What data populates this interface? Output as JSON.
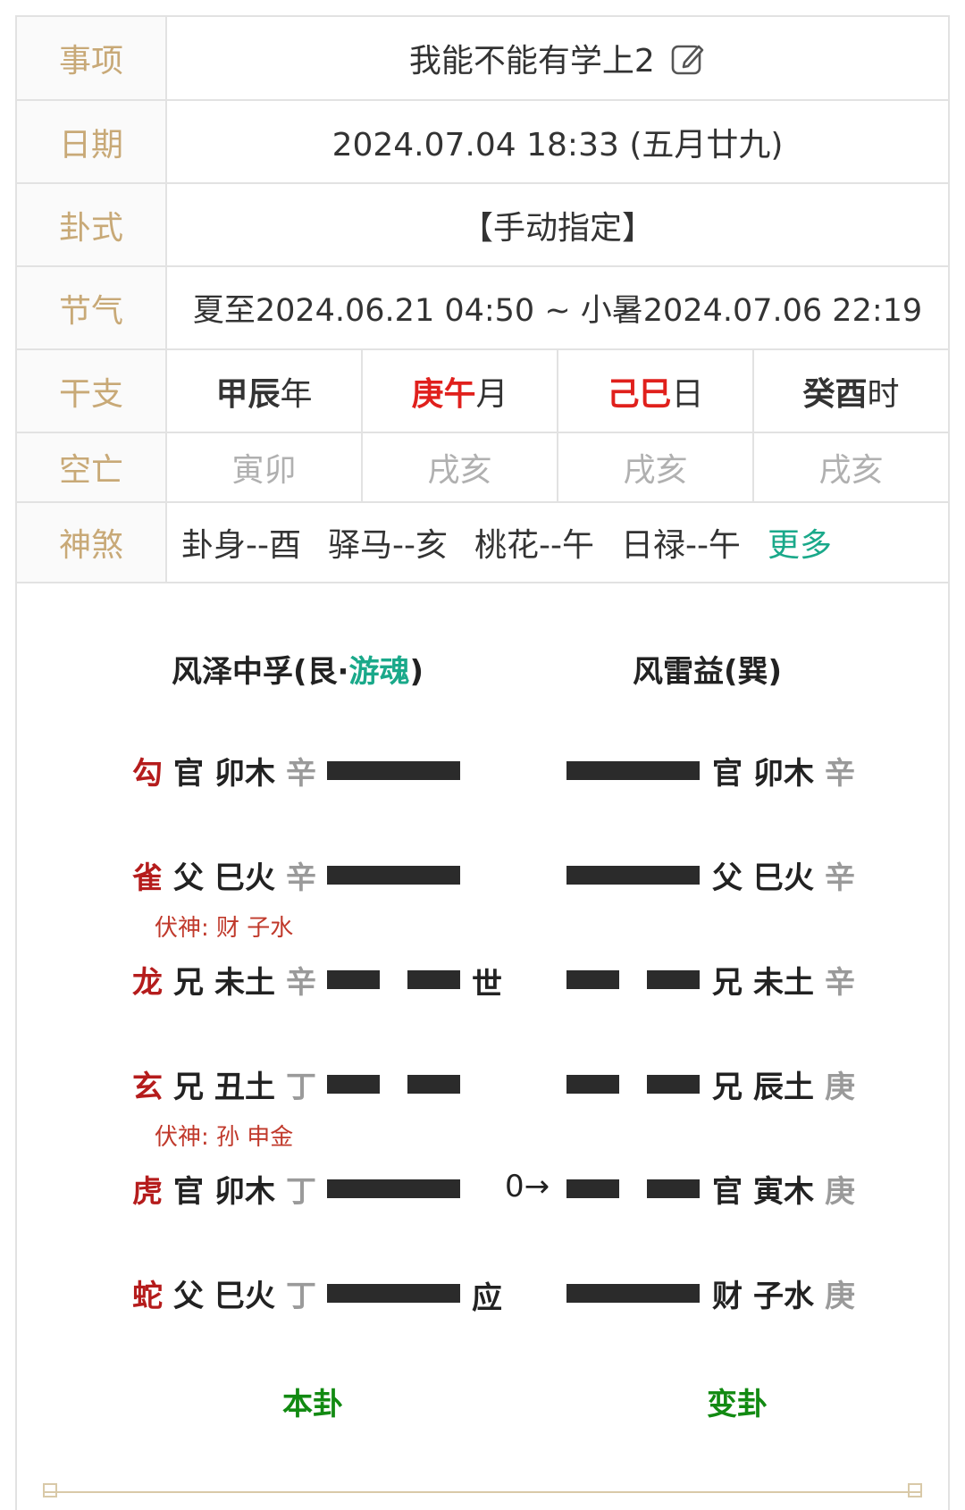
{
  "rows": {
    "matter": {
      "label": "事项",
      "value": "我能不能有学上2"
    },
    "date": {
      "label": "日期",
      "value": "2024.07.04 18:33 (五月廿九)"
    },
    "method": {
      "label": "卦式",
      "value": "【手动指定】"
    },
    "solar_term": {
      "label": "节气",
      "value": "夏至2024.06.21 04:50 ~ 小暑2024.07.06 22:19"
    },
    "ganzhi": {
      "label": "干支",
      "items": [
        {
          "main": "甲辰",
          "suffix": "年",
          "color": "#333333"
        },
        {
          "main": "庚午",
          "suffix": "月",
          "color": "#e0201c"
        },
        {
          "main": "己巳",
          "suffix": "日",
          "color": "#e0201c"
        },
        {
          "main": "癸酉",
          "suffix": "时",
          "color": "#333333"
        }
      ]
    },
    "kongwang": {
      "label": "空亡",
      "items": [
        "寅卯",
        "戌亥",
        "戌亥",
        "戌亥"
      ]
    },
    "shensha": {
      "label": "神煞",
      "items": [
        "卦身--酉",
        "驿马--亥",
        "桃花--午",
        "日禄--午"
      ],
      "more": "更多"
    }
  },
  "hexagram": {
    "left_title": {
      "prefix": "风泽中孚(艮·",
      "highlight": "游魂",
      "suffix": ")"
    },
    "right_title": "风雷益(巽)",
    "lines": [
      {
        "god": "勾",
        "rel": "官",
        "branch": "卯木",
        "stem": "辛",
        "left_yang": true,
        "mark": "",
        "change": "",
        "right_yang": true,
        "r_rel": "官",
        "r_branch": "卯木",
        "r_stem": "辛"
      },
      {
        "god": "雀",
        "rel": "父",
        "branch": "巳火",
        "stem": "辛",
        "left_yang": true,
        "mark": "",
        "change": "",
        "right_yang": true,
        "r_rel": "父",
        "r_branch": "巳火",
        "r_stem": "辛"
      },
      {
        "god": "龙",
        "rel": "兄",
        "branch": "未土",
        "stem": "辛",
        "left_yang": false,
        "mark": "世",
        "change": "",
        "right_yang": false,
        "r_rel": "兄",
        "r_branch": "未土",
        "r_stem": "辛"
      },
      {
        "god": "玄",
        "rel": "兄",
        "branch": "丑土",
        "stem": "丁",
        "left_yang": false,
        "mark": "",
        "change": "",
        "right_yang": false,
        "r_rel": "兄",
        "r_branch": "辰土",
        "r_stem": "庚"
      },
      {
        "god": "虎",
        "rel": "官",
        "branch": "卯木",
        "stem": "丁",
        "left_yang": true,
        "mark": "",
        "change": "0→",
        "right_yang": false,
        "r_rel": "官",
        "r_branch": "寅木",
        "r_stem": "庚"
      },
      {
        "god": "蛇",
        "rel": "父",
        "branch": "巳火",
        "stem": "丁",
        "left_yang": true,
        "mark": "应",
        "change": "",
        "right_yang": true,
        "r_rel": "财",
        "r_branch": "子水",
        "r_stem": "庚"
      }
    ],
    "fushen": [
      "伏神:  财  子水",
      "伏神:  孙  申金"
    ],
    "ben_gua": "本卦",
    "bian_gua": "变卦"
  }
}
